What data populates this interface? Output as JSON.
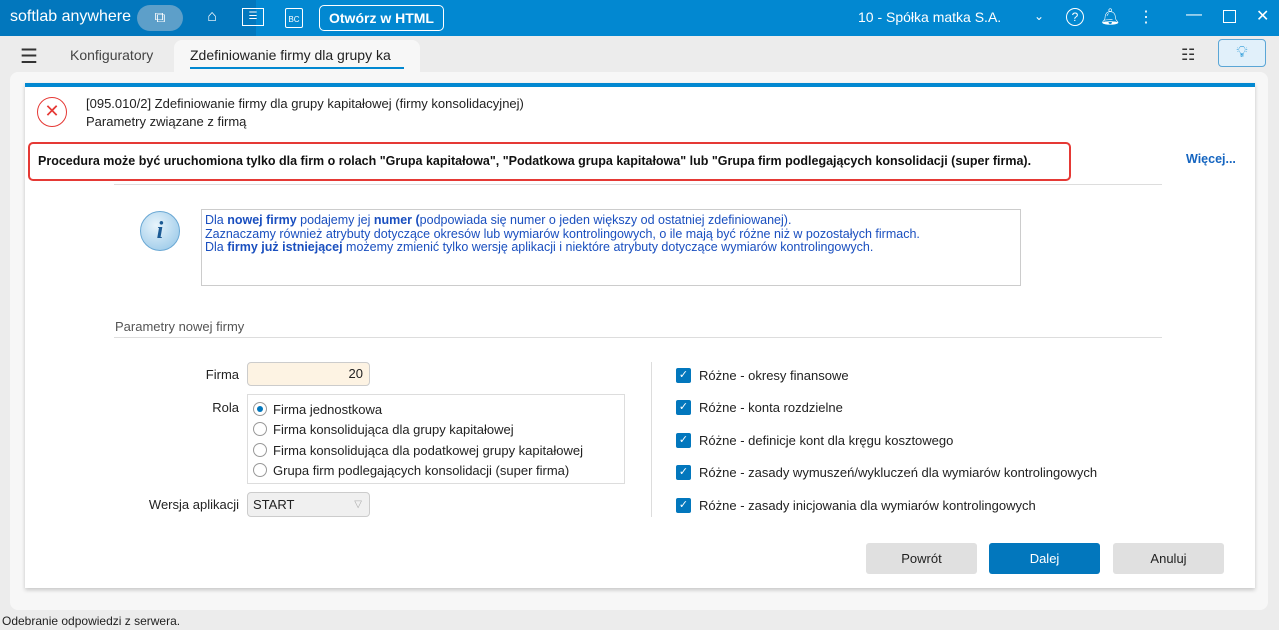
{
  "titlebar": {
    "brand": "softlab anywhere",
    "open_html": "Otwórz w HTML",
    "company": "10 - Spółka matka S.A.",
    "bc_icon_text": "BC"
  },
  "tabs": [
    {
      "label": "Konfiguratory"
    },
    {
      "label": "Zdefiniowanie firmy dla grupy ka"
    }
  ],
  "dialog": {
    "title": "[095.010/2] Zdefiniowanie firmy dla grupy kapitałowej (firmy konsolidacyjnej)",
    "subtitle": "Parametry związane z firmą",
    "warning": "Procedura może być uruchomiona tylko dla firm o rolach \"Grupa kapitałowa\", \"Podatkowa grupa kapitałowa\" lub \"Grupa firm podlegających konsolidacji (super firma).",
    "more": "Więcej...",
    "info": {
      "l1a": "Dla ",
      "l1b": "nowej firmy",
      "l1c": " podajemy jej  ",
      "l1d": "numer  (",
      "l1e": "podpowiada się  numer o jeden większy od ostatniej zdefiniowanej).",
      "l2": "Zaznaczamy również atrybuty dotyczące okresów lub wymiarów kontrolingowych,  o ile mają być różne niż w pozostałych firmach.",
      "l3a": "Dla ",
      "l3b": "firmy już  istniejącej",
      "l3c": " możemy zmienić tylko wersję aplikacji i niektóre atrybuty dotyczące wymiarów kontrolingowych."
    },
    "section": "Parametry nowej firmy",
    "firma_label": "Firma",
    "firma_value": "20",
    "rola_label": "Rola",
    "roles": [
      {
        "label": "Firma jednostkowa",
        "selected": true
      },
      {
        "label": "Firma konsolidująca dla grupy kapitałowej",
        "selected": false
      },
      {
        "label": "Firma konsolidująca dla podatkowej grupy kapitałowej",
        "selected": false
      },
      {
        "label": "Grupa firm podlegających konsolidacji (super firma)",
        "selected": false
      }
    ],
    "wersja_label": "Wersja aplikacji",
    "wersja_value": "START",
    "checks": [
      {
        "label": "Różne - okresy finansowe",
        "checked": true
      },
      {
        "label": "Różne - konta rozdzielne",
        "checked": true
      },
      {
        "label": "Różne - definicje kont dla kręgu kosztowego",
        "checked": true
      },
      {
        "label": "Różne - zasady wymuszeń/wykluczeń dla wymiarów kontrolingowych",
        "checked": true
      },
      {
        "label": "Różne - zasady inicjowania dla wymiarów kontrolingowych",
        "checked": true
      }
    ],
    "buttons": {
      "back": "Powrót",
      "next": "Dalej",
      "cancel": "Anuluj"
    }
  },
  "status": "Odebranie odpowiedzi z serwera.",
  "colors": {
    "accent": "#0288d1",
    "warning_border": "#e53935",
    "info_text": "#1a4fbf"
  }
}
